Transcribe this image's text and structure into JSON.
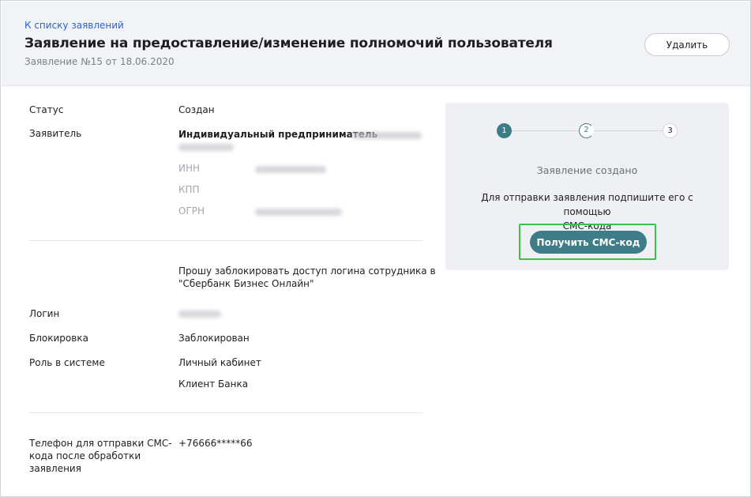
{
  "header": {
    "back_link": "К списку заявлений",
    "title": "Заявление на предоставление/изменение полномочий пользователя",
    "subtitle": "Заявление №15 от 18.06.2020",
    "delete_label": "Удалить"
  },
  "details": {
    "status_label": "Статус",
    "status_value": "Создан",
    "applicant_label": "Заявитель",
    "applicant_value": "Индивидуальный предприниматель",
    "inn_label": "ИНН",
    "kpp_label": "КПП",
    "ogrn_label": "ОГРН",
    "request_text_line1": "Прошу заблокировать доступ логина сотрудника в",
    "request_text_line2": "\"Сбербанк Бизнес Онлайн\"",
    "login_label": "Логин",
    "block_label": "Блокировка",
    "block_value": "Заблокирован",
    "role_label": "Роль в системе",
    "role_value_1": "Личный кабинет",
    "role_value_2": "Клиент Банка",
    "phone_label_line1": "Телефон для отправки СМС-",
    "phone_label_line2": "кода после обработки",
    "phone_label_line3": "заявления",
    "phone_value": "+76666*****66"
  },
  "panel": {
    "steps": [
      "1",
      "2",
      "3"
    ],
    "current_step": 2,
    "status_title": "Заявление создано",
    "description_line1": "Для отправки заявления подпишите его с помощью",
    "description_line2": "СМС-кода",
    "sms_button": "Получить СМС-код",
    "accent_color": "#3e7c87",
    "highlight_color": "#3fbf4a"
  }
}
